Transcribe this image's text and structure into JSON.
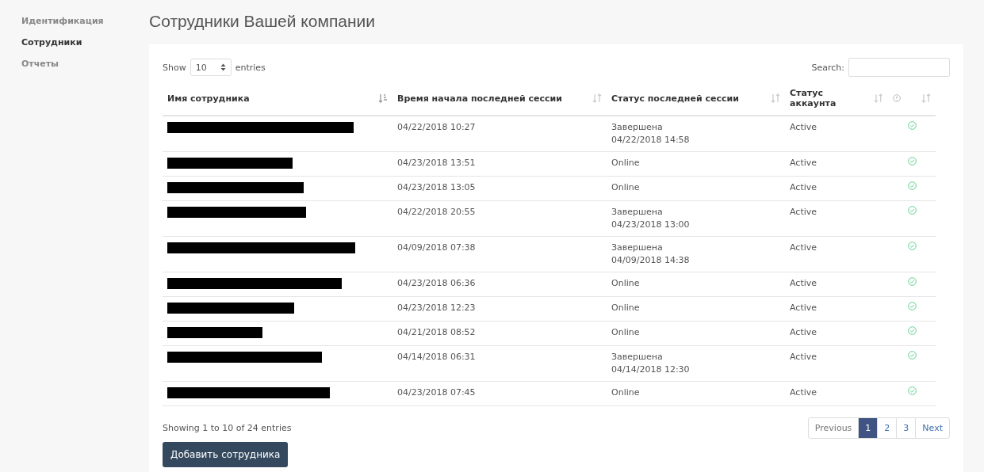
{
  "sidebar": {
    "items": [
      {
        "label": "Идентификация",
        "selected": false
      },
      {
        "label": "Сотрудники",
        "selected": true
      },
      {
        "label": "Отчеты",
        "selected": false
      }
    ]
  },
  "title": "Сотрудники Вашей компании",
  "length_control": {
    "label_before": "Show",
    "value": "10",
    "label_after": "entries"
  },
  "search": {
    "label": "Search:"
  },
  "table": {
    "columns": [
      {
        "label": "Имя сотрудника",
        "sorted": true
      },
      {
        "label": "Время начала последней сессии",
        "sorted": false
      },
      {
        "label": "Статус последней сессии",
        "sorted": false
      },
      {
        "label": "Статус аккаунта",
        "sorted": false
      },
      {
        "kind": "icon",
        "sorted": false
      }
    ],
    "rows": [
      {
        "name_redacted": true,
        "start": "04/22/2018 10:27",
        "session": [
          "Завершена",
          "04/22/2018 14:58"
        ],
        "account": "Active",
        "active": true
      },
      {
        "name_redacted": true,
        "start": "04/23/2018 13:51",
        "session": [
          "Online"
        ],
        "account": "Active",
        "active": true
      },
      {
        "name_redacted": true,
        "start": "04/23/2018 13:05",
        "session": [
          "Online"
        ],
        "account": "Active",
        "active": true
      },
      {
        "name_redacted": true,
        "start": "04/22/2018 20:55",
        "session": [
          "Завершена",
          "04/23/2018 13:00"
        ],
        "account": "Active",
        "active": true
      },
      {
        "name_redacted": true,
        "start": "04/09/2018 07:38",
        "session": [
          "Завершена",
          "04/09/2018 14:38"
        ],
        "account": "Active",
        "active": true
      },
      {
        "name_redacted": true,
        "start": "04/23/2018 06:36",
        "session": [
          "Online"
        ],
        "account": "Active",
        "active": true
      },
      {
        "name_redacted": true,
        "start": "04/23/2018 12:23",
        "session": [
          "Online"
        ],
        "account": "Active",
        "active": true
      },
      {
        "name_redacted": true,
        "start": "04/21/2018 08:52",
        "session": [
          "Online"
        ],
        "account": "Active",
        "active": true
      },
      {
        "name_redacted": true,
        "start": "04/14/2018 06:31",
        "session": [
          "Завершена",
          "04/14/2018 12:30"
        ],
        "account": "Active",
        "active": true
      },
      {
        "name_redacted": true,
        "start": "04/23/2018 07:45",
        "session": [
          "Online"
        ],
        "account": "Active",
        "active": true
      }
    ]
  },
  "info": "Showing 1 to 10 of 24 entries",
  "pagination": {
    "previous": "Previous",
    "pages": [
      {
        "label": "1",
        "selected": true
      },
      {
        "label": "2",
        "selected": false
      },
      {
        "label": "3",
        "selected": false
      }
    ],
    "next": "Next"
  },
  "add_button": "Добавить сотрудника"
}
